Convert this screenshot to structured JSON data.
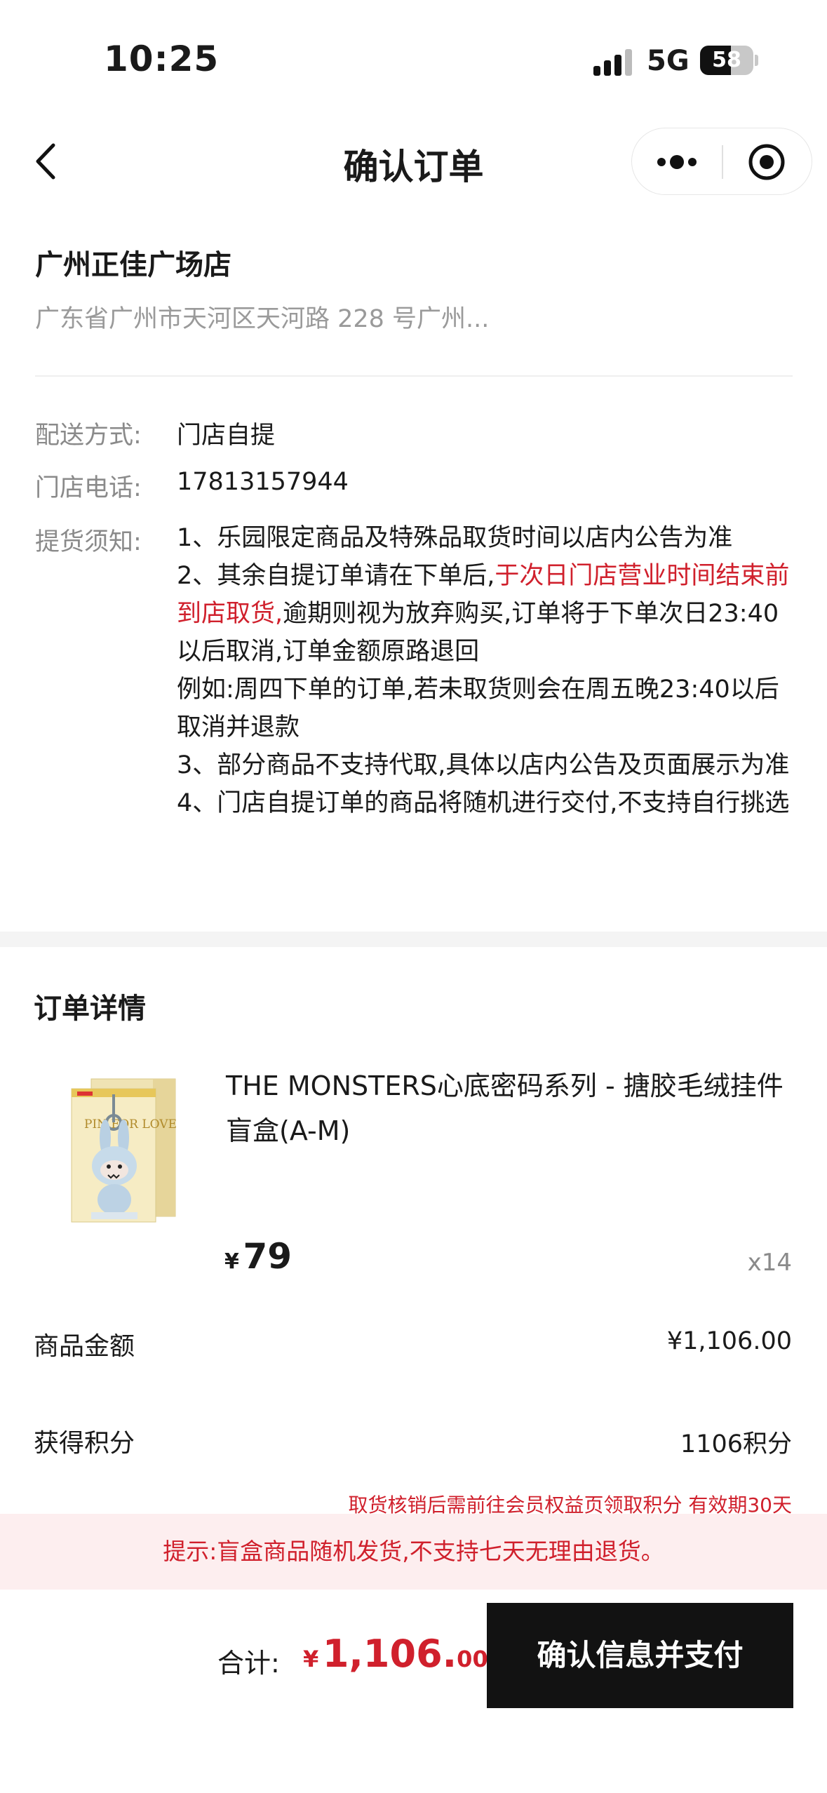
{
  "status": {
    "time": "10:25",
    "network": "5G",
    "battery": "58"
  },
  "nav": {
    "title": "确认订单"
  },
  "store": {
    "name": "广州正佳广场店",
    "address": "广东省广州市天河区天河路 228 号广州..."
  },
  "delivery": {
    "label": "配送方式:",
    "value": "门店自提"
  },
  "phone": {
    "label": "门店电话:",
    "value": "17813157944"
  },
  "notice": {
    "label": "提货须知:",
    "line1": "1、乐园限定商品及特殊品取货时间以店内公告为准",
    "line2_start": "2、其余自提订单请在下单后,",
    "line2_red": "于次日门店营业时间结束前到店取货,",
    "line2_end": "逾期则视为放弃购买,订单将于下单次日23:40以后取消,订单金额原路退回",
    "example": "例如:周四下单的订单,若未取货则会在周五晚23:40以后取消并退款",
    "line3": "3、部分商品不支持代取,具体以店内公告及页面展示为准",
    "line4": "4、门店自提订单的商品将随机进行交付,不支持自行挑选"
  },
  "order": {
    "title": "订单详情",
    "product_name": "THE MONSTERS心底密码系列 - 搪胶毛绒挂件盲盒(A-M)",
    "currency": "¥",
    "price": "79",
    "qty": "x14",
    "product_box_text": "PIN FOR LOVE"
  },
  "goods_amount": {
    "label": "商品金额",
    "value": "¥1,106.00"
  },
  "points": {
    "label": "获得积分",
    "value": "1106积分",
    "note": "取货核销后需前往会员权益页领取积分 有效期30天"
  },
  "tip": "提示:盲盒商品随机发货,不支持七天无理由退货。",
  "footer": {
    "total_label": "合计:",
    "currency": "¥",
    "total_int": "1,106.",
    "total_dec": "00",
    "pay_label": "确认信息并支付"
  }
}
